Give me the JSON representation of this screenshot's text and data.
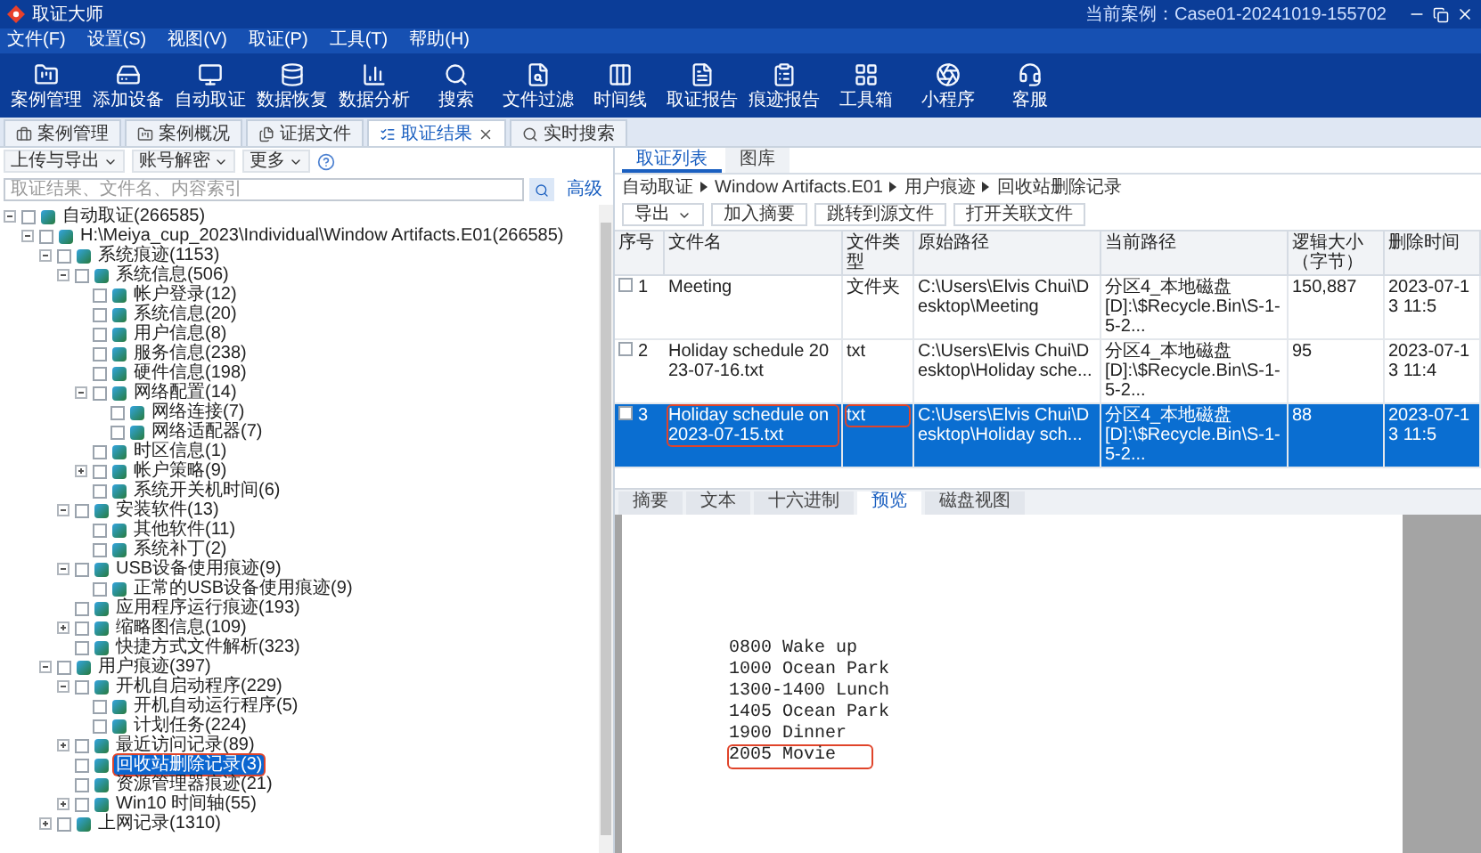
{
  "window": {
    "title": "取证大师",
    "current_case": "当前案例：Case01-20241019-155702"
  },
  "menu": [
    "文件(F)",
    "设置(S)",
    "视图(V)",
    "取证(P)",
    "工具(T)",
    "帮助(H)"
  ],
  "toolbar": [
    "案例管理",
    "添加设备",
    "自动取证",
    "数据恢复",
    "数据分析",
    "搜索",
    "文件过滤",
    "时间线",
    "取证报告",
    "痕迹报告",
    "工具箱",
    "小程序",
    "客服"
  ],
  "tabs": [
    {
      "label": "案例管理",
      "selected": false
    },
    {
      "label": "案例概况",
      "selected": false
    },
    {
      "label": "证据文件",
      "selected": false
    },
    {
      "label": "取证结果",
      "selected": true
    },
    {
      "label": "实时搜索",
      "selected": false
    }
  ],
  "left_toolbar": [
    "上传与导出",
    "账号解密",
    "更多"
  ],
  "search": {
    "placeholder": "取证结果、文件名、内容索引",
    "advanced": "高级"
  },
  "tree": [
    {
      "label": "自动取证(266585)",
      "checked": false,
      "selected": false,
      "expanded": true,
      "children": [
        {
          "label": "H:\\Meiya_cup_2023\\Individual\\Window Artifacts.E01(266585)",
          "checked": false,
          "selected": false,
          "expanded": true,
          "children": [
            {
              "label": "系统痕迹(1153)",
              "checked": false,
              "selected": false,
              "expanded": true,
              "children": [
                {
                  "label": "系统信息(506)",
                  "checked": false,
                  "selected": false,
                  "expanded": true,
                  "children": [
                    {
                      "label": "帐户登录(12)",
                      "checked": false,
                      "selected": false
                    },
                    {
                      "label": "系统信息(20)",
                      "checked": false,
                      "selected": false
                    },
                    {
                      "label": "用户信息(8)",
                      "checked": false,
                      "selected": false
                    },
                    {
                      "label": "服务信息(238)",
                      "checked": false,
                      "selected": false
                    },
                    {
                      "label": "硬件信息(198)",
                      "checked": false,
                      "selected": false
                    },
                    {
                      "label": "网络配置(14)",
                      "checked": false,
                      "selected": false,
                      "expanded": true,
                      "children": [
                        {
                          "label": "网络连接(7)",
                          "checked": false,
                          "selected": false
                        },
                        {
                          "label": "网络适配器(7)",
                          "checked": false,
                          "selected": false
                        }
                      ]
                    },
                    {
                      "label": "时区信息(1)",
                      "checked": false,
                      "selected": false
                    },
                    {
                      "label": "帐户策略(9)",
                      "checked": false,
                      "selected": false,
                      "expanded": false
                    },
                    {
                      "label": "系统开关机时间(6)",
                      "checked": false,
                      "selected": false
                    }
                  ]
                },
                {
                  "label": "安装软件(13)",
                  "checked": false,
                  "selected": false,
                  "expanded": true,
                  "children": [
                    {
                      "label": "其他软件(11)",
                      "checked": false,
                      "selected": false
                    },
                    {
                      "label": "系统补丁(2)",
                      "checked": false,
                      "selected": false
                    }
                  ]
                },
                {
                  "label": "USB设备使用痕迹(9)",
                  "checked": false,
                  "selected": false,
                  "expanded": true,
                  "children": [
                    {
                      "label": "正常的USB设备使用痕迹(9)",
                      "checked": false,
                      "selected": false
                    }
                  ]
                },
                {
                  "label": "应用程序运行痕迹(193)",
                  "checked": false,
                  "selected": false
                },
                {
                  "label": "缩略图信息(109)",
                  "checked": false,
                  "selected": false,
                  "expanded": false
                },
                {
                  "label": "快捷方式文件解析(323)",
                  "checked": false,
                  "selected": false
                }
              ]
            },
            {
              "label": "用户痕迹(397)",
              "checked": false,
              "selected": false,
              "expanded": true,
              "children": [
                {
                  "label": "开机自启动程序(229)",
                  "checked": false,
                  "selected": false,
                  "expanded": true,
                  "children": [
                    {
                      "label": "开机自动运行程序(5)",
                      "checked": false,
                      "selected": false
                    },
                    {
                      "label": "计划任务(224)",
                      "checked": false,
                      "selected": false
                    }
                  ]
                },
                {
                  "label": "最近访问记录(89)",
                  "checked": false,
                  "selected": false,
                  "expanded": false
                },
                {
                  "label": "回收站删除记录(3)",
                  "checked": false,
                  "selected": true,
                  "outlined": true
                },
                {
                  "label": "资源管理器痕迹(21)",
                  "checked": false,
                  "selected": false
                },
                {
                  "label": "Win10 时间轴(55)",
                  "checked": false,
                  "selected": false,
                  "expanded": false
                }
              ]
            },
            {
              "label": "上网记录(1310)",
              "checked": false,
              "selected": false,
              "expanded": false
            }
          ]
        }
      ]
    }
  ],
  "result_tabs": [
    {
      "label": "取证列表",
      "selected": true
    },
    {
      "label": "图库",
      "selected": false
    }
  ],
  "breadcrumb": [
    "自动取证",
    "Window Artifacts.E01",
    "用户痕迹",
    "回收站删除记录"
  ],
  "actions": [
    {
      "label": "导出",
      "dropdown": true
    },
    {
      "label": "加入摘要",
      "dropdown": false
    },
    {
      "label": "跳转到源文件",
      "dropdown": false
    },
    {
      "label": "打开关联文件",
      "dropdown": false
    }
  ],
  "table": {
    "columns": [
      "序号",
      "文件名",
      "文件类型",
      "原始路径",
      "当前路径",
      "逻辑大小（字节）",
      "删除时间"
    ],
    "rows": [
      {
        "checked": false,
        "selected": false,
        "outlined": false,
        "cells": [
          "1",
          "Meeting",
          "文件夹",
          "C:\\Users\\Elvis Chui\\Desktop\\Meeting",
          "分区4_本地磁盘[D]:\\$Recycle.Bin\\S-1-5-2...",
          "150,887",
          "2023-07-13 11:5"
        ]
      },
      {
        "checked": false,
        "selected": false,
        "outlined": false,
        "cells": [
          "2",
          "Holiday schedule 2023-07-16.txt",
          "txt",
          "C:\\Users\\Elvis Chui\\Desktop\\Holiday sche...",
          "分区4_本地磁盘[D]:\\$Recycle.Bin\\S-1-5-2...",
          "95",
          "2023-07-13 11:4"
        ]
      },
      {
        "checked": false,
        "selected": true,
        "outlined": true,
        "cells": [
          "3",
          "Holiday schedule on 2023-07-15.txt",
          "txt",
          "C:\\Users\\Elvis Chui\\Desktop\\Holiday sch...",
          "分区4_本地磁盘[D]:\\$Recycle.Bin\\S-1-5-2...",
          "88",
          "2023-07-13 11:5"
        ]
      }
    ]
  },
  "detail_tabs": [
    {
      "label": "摘要",
      "selected": false
    },
    {
      "label": "文本",
      "selected": false
    },
    {
      "label": "十六进制",
      "selected": false
    },
    {
      "label": "预览",
      "selected": true
    },
    {
      "label": "磁盘视图",
      "selected": false
    }
  ],
  "preview": [
    {
      "text": "0800 Wake up",
      "outlined": false
    },
    {
      "text": "1000 Ocean Park",
      "outlined": false
    },
    {
      "text": "1300-1400 Lunch",
      "outlined": false
    },
    {
      "text": "1405 Ocean Park",
      "outlined": false
    },
    {
      "text": "1900 Dinner",
      "outlined": false
    },
    {
      "text": "2005 Movie",
      "outlined": true
    }
  ]
}
